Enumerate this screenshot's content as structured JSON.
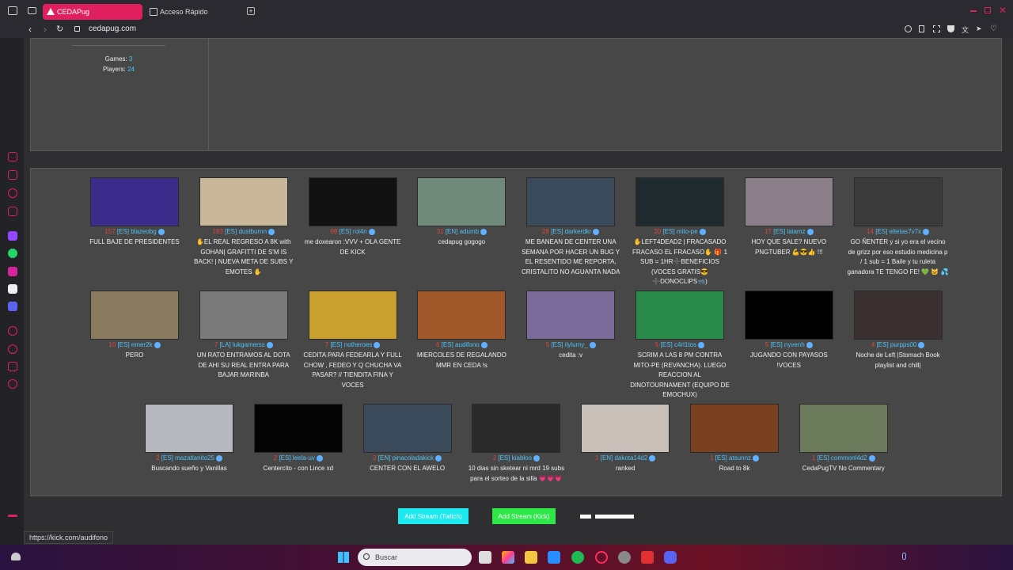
{
  "browser": {
    "tabs": [
      {
        "label": "CEDAPug",
        "active": true
      },
      {
        "label": "Acceso Rápido",
        "active": false
      }
    ],
    "url": "cedapug.com",
    "status_url": "https://kick.com/audifono"
  },
  "stats": {
    "games_label": "Games:",
    "games_value": "3",
    "players_label": "Players:",
    "players_value": "24"
  },
  "streams": [
    {
      "viewers": "157",
      "channel": "[ES] blazeobg",
      "title": "FULL BAJE DE PRESIDENTES",
      "thumb": "#3b2b8a"
    },
    {
      "viewers": "183",
      "channel": "[ES] dustburnn",
      "title": "✋EL REAL REGRESO A 8K with GOHAN| GRAFITTI DE S'M IS BACK! | NUEVA META DE SUBS Y EMOTES ✋",
      "thumb": "#c9b79a"
    },
    {
      "viewers": "68",
      "channel": "[ES] rol4n",
      "title": "me doxearon :VVV + OLA GENTE DE KICK",
      "thumb": "#111111"
    },
    {
      "viewers": "31",
      "channel": "[EN] adumb",
      "title": "cedapug gogogo",
      "thumb": "#6f8a7a"
    },
    {
      "viewers": "28",
      "channel": "[ES] darkerdkr",
      "title": "ME BANEAN DE CENTER UNA SEMANA POR HACER UN BUG Y EL RESENTIDO ME REPORTA, CRISTALITO NO AGUANTA NADA",
      "thumb": "#3a4a5a"
    },
    {
      "viewers": "20",
      "channel": "[ES] mito-pe",
      "title": "✋LEFT4DEAD2 | FRACASADO FRACASO EL FRACASO✋ 🎁 1 SUB = 1HR➕BENEFICIOS (VOCES GRATIS😎➕DONOCLIPS📹)",
      "thumb": "#1f2a2f"
    },
    {
      "viewers": "17",
      "channel": "[ES] laiamz",
      "title": "HOY QUE SALE? NUEVO PNGTUBER 💪😎👍 !!!",
      "thumb": "#8a7f88"
    },
    {
      "viewers": "14",
      "channel": "[ES] eltetas7v7x",
      "title": "GO ÑENTER y si yo era el vecino de grizz por eso estudio medicina p / 1 sub = 1 Baile y tu ruleta ganadora TE TENGO FE! 💚 🐱 💦",
      "thumb": "#3a3a3a"
    },
    {
      "viewers": "10",
      "channel": "[ES] emer2k",
      "title": "PERO",
      "thumb": "#8a7a60"
    },
    {
      "viewers": "7",
      "channel": "[LA] lukgamerss",
      "title": "UN RATO ENTRAMOS AL DOTA DE AHI SU REAL ENTRA PARA BAJAR MARINBA",
      "thumb": "#7a7a7a"
    },
    {
      "viewers": "7",
      "channel": "[ES] notheroes",
      "title": "CEDITA PARA FEDEARLA Y FULL CHOW , FEDEO Y Q CHUCHA VA PASAR? // TIENDITA FINA Y VOCES",
      "thumb": "#c9a030"
    },
    {
      "viewers": "6",
      "channel": "[ES] audifono",
      "title": "MIERCOLES DE REGALANDO MMR EN CEDA !s",
      "thumb": "#a0582a"
    },
    {
      "viewers": "5",
      "channel": "[ES] ilylumy_",
      "title": "cedita :v",
      "thumb": "#7a6a9a"
    },
    {
      "viewers": "5",
      "channel": "[ES] c4rl1tos",
      "title": "SCRIM A LAS 8 PM CONTRA MITO-PE (REVANCHA). LUEGO REACCION AL DINOTOURNAMENT (EQUIPO DE EMOCHUX)",
      "thumb": "#2a8a4a"
    },
    {
      "viewers": "5",
      "channel": "[ES] nyvenh",
      "title": "JUGANDO CON PAYASOS !VOCES",
      "thumb": "#000000"
    },
    {
      "viewers": "4",
      "channel": "[ES] purpps00",
      "title": "Noche de Left |Stomach Book playlist and chill|",
      "thumb": "#3a3030"
    },
    {
      "viewers": "2",
      "channel": "[ES] mazatlanito25",
      "title": "Buscando sueño y Vanillas",
      "thumb": "#b8b8c0"
    },
    {
      "viewers": "2",
      "channel": "[ES] leela-uv",
      "title": "Centercito - con Lince xd",
      "thumb": "#050505"
    },
    {
      "viewers": "2",
      "channel": "[EN] pinacoladakick",
      "title": "CENTER CON EL AWELO",
      "thumb": "#3a4a5a"
    },
    {
      "viewers": "2",
      "channel": "[ES] kiabloo",
      "title": "10 dias sin sketear ni mrd 19 subs para el sorteo de la silla 💗💗💗",
      "thumb": "#2a2a2a"
    },
    {
      "viewers": "1",
      "channel": "[EN] dakota14d2",
      "title": "ranked",
      "thumb": "#c8c0b8"
    },
    {
      "viewers": "1",
      "channel": "[ES] atsunnz",
      "title": "Road to 8k",
      "thumb": "#7a4020"
    },
    {
      "viewers": "1",
      "channel": "[ES] commonl4d2",
      "title": "CedaPugTV No Commentary",
      "thumb": "#6a7a5a"
    }
  ],
  "buttons": {
    "twitch": "Add Stream (Twitch)",
    "kick": "Add Stream (Kick)"
  },
  "taskbar": {
    "search_placeholder": "Buscar"
  },
  "colors": {
    "accent": "#e0205e",
    "link": "#4fc3f7",
    "twitch_btn": "#1de9f0",
    "kick_btn": "#2ee84a"
  }
}
